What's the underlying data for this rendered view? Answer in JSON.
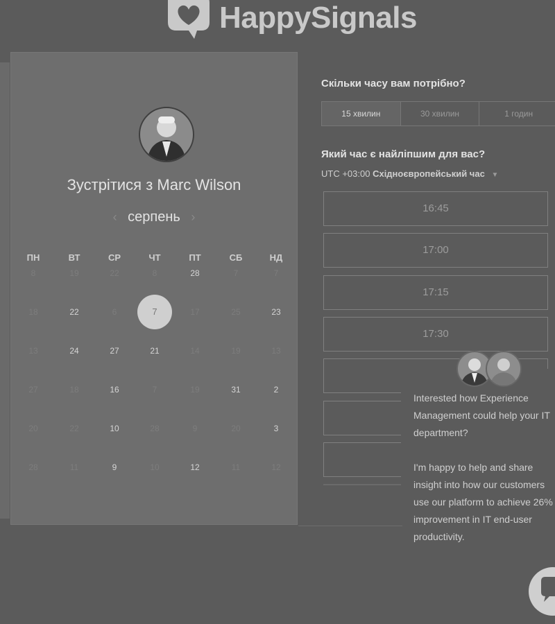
{
  "brand": {
    "name": "HappySignals"
  },
  "calendar": {
    "title": "Зустрітися з Marc Wilson",
    "month": "серпень",
    "weekdays": [
      "ПН",
      "ВТ",
      "СР",
      "ЧТ",
      "ПТ",
      "СБ",
      "НД"
    ],
    "rows": [
      [
        {
          "d": "8",
          "a": false
        },
        {
          "d": "19",
          "a": false
        },
        {
          "d": "22",
          "a": false
        },
        {
          "d": "8",
          "a": false
        },
        {
          "d": "28",
          "a": true
        },
        {
          "d": "7",
          "a": false
        },
        {
          "d": "7",
          "a": false
        }
      ],
      [
        {
          "d": "18",
          "a": false
        },
        {
          "d": "22",
          "a": true
        },
        {
          "d": "6",
          "a": false
        },
        {
          "d": "7",
          "a": true,
          "selected": true
        },
        {
          "d": "17",
          "a": false
        },
        {
          "d": "25",
          "a": false
        },
        {
          "d": "23",
          "a": true
        }
      ],
      [
        {
          "d": "13",
          "a": false
        },
        {
          "d": "24",
          "a": true
        },
        {
          "d": "27",
          "a": true
        },
        {
          "d": "21",
          "a": true
        },
        {
          "d": "14",
          "a": false
        },
        {
          "d": "19",
          "a": false
        },
        {
          "d": "13",
          "a": false
        }
      ],
      [
        {
          "d": "27",
          "a": false
        },
        {
          "d": "18",
          "a": false
        },
        {
          "d": "16",
          "a": true
        },
        {
          "d": "7",
          "a": false
        },
        {
          "d": "19",
          "a": false
        },
        {
          "d": "31",
          "a": true
        },
        {
          "d": "2",
          "a": true
        }
      ],
      [
        {
          "d": "20",
          "a": false
        },
        {
          "d": "22",
          "a": false
        },
        {
          "d": "10",
          "a": true
        },
        {
          "d": "28",
          "a": false
        },
        {
          "d": "9",
          "a": false
        },
        {
          "d": "20",
          "a": false
        },
        {
          "d": "3",
          "a": true
        }
      ],
      [
        {
          "d": "28",
          "a": false
        },
        {
          "d": "11",
          "a": false
        },
        {
          "d": "9",
          "a": true
        },
        {
          "d": "10",
          "a": false
        },
        {
          "d": "12",
          "a": true
        },
        {
          "d": "11",
          "a": false
        },
        {
          "d": "12",
          "a": false
        }
      ]
    ]
  },
  "duration": {
    "question": "Скільки часу вам потрібно?",
    "options": [
      "15 хвилин",
      "30 хвилин",
      "1 годин"
    ],
    "selected": "15 хвилин"
  },
  "timepick": {
    "question": "Який час є найліпшим для вас?",
    "tz_offset": "UTC +03:00",
    "tz_name": "Східноєвропейський час",
    "slots": [
      "16:45",
      "17:00",
      "17:15",
      "17:30"
    ]
  },
  "chat": {
    "paragraph1": "Interested how Experience Management could help your IT department?",
    "paragraph2": "I'm happy to help and share insight into how our customers use our platform to achieve 26% improvement in IT end-user productivity."
  },
  "icons": {
    "logo": "heart-speech-bubble-icon",
    "month_prev": "chevron-left-icon",
    "month_next": "chevron-right-icon",
    "tz_dropdown": "caret-down-icon",
    "chat_launcher": "chat-bubble-icon"
  }
}
